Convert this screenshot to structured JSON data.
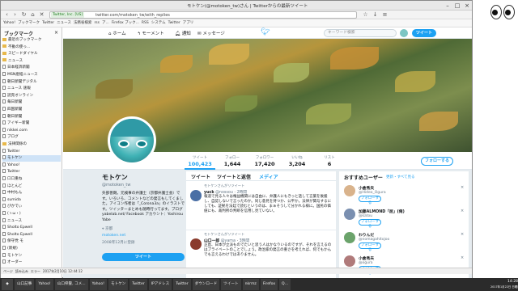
{
  "window": {
    "title": "モトケン(@motoken_tw)さん | Twitterからの最新ツイート"
  },
  "toolbar": {
    "url_badge": "Twitter, Inc. [US]",
    "url": "twitter.com/motoken_tw/with_replies"
  },
  "bookmarks": [
    "Yahoo!",
    "ブックマーク",
    "Twitter",
    "ニュース",
    "法務省検索",
    "rss",
    "ア...",
    "Firefox ブック...",
    "RSS",
    "システム",
    "Twitter",
    "アプリ"
  ],
  "sidebar": {
    "title": "ブックマーク",
    "rows": [
      "最近のブックマーク",
      "不動の使っ...",
      "スピードダイヤル",
      "ニュース",
      "日本経済新聞",
      "MSN産経ニュース",
      "朝日新聞デジタル",
      "ニュース 速報",
      "読売オンライン",
      "毎日新聞",
      "四国新聞",
      "朝日新聞",
      "アイギー新聞",
      "nikkei.com",
      "ブログ",
      "法律関係の",
      "Twitter",
      "モトケン",
      "Yahoo!",
      "Twitter",
      "口口重ね",
      "ほとんど",
      "中村もん",
      "sumida",
      "ぴかでぃ",
      "(ゝω・)",
      "ニュース",
      "Sholto Epwell",
      "Sholto Epwell",
      "保守党 モ",
      "(新規)",
      "モトケン",
      "オーダー"
    ]
  },
  "statusbar": [
    "ページ",
    "読み込み",
    "エラー",
    "2017年2月10日 12:44:12"
  ],
  "twitter": {
    "nav": {
      "home": "ホーム",
      "moments": "モーメント",
      "notifications": "通知",
      "messages": "メッセージ",
      "search_placeholder": "キーワード検索",
      "tweet": "ツイート"
    },
    "stats": [
      {
        "label": "ツイート",
        "value": "100,423"
      },
      {
        "label": "フォロー",
        "value": "1,644"
      },
      {
        "label": "フォロワー",
        "value": "17,420"
      },
      {
        "label": "いいね",
        "value": "3,204"
      },
      {
        "label": "リスト",
        "value": "6"
      }
    ],
    "follow_button": "フォローする",
    "profile": {
      "name": "モトケン",
      "handle": "@motoken_tw",
      "bio": "矢部善朗。元検事の弁護士（京都弁護士会）です。いろいろ、コメントなどの発言もしてくました。アイコン作者は「_Corona3a」のイラストです。ツイッターまとめも随時行ってます。ブログ yabelab.net/ Facebook アカウント：Yoshirou Yabe",
      "location": "京都",
      "link": "motoken.net",
      "joined": "2008年12月に登録",
      "tweet_button": "ツイート"
    },
    "tabs": [
      "ツイート",
      "ツイートと返信",
      "メディア"
    ],
    "tweets": [
      {
        "rt": "モトケンさんがリツイート",
        "name": "yuck",
        "handle": "@nossou",
        "time": "2時間",
        "text": "報道で見る人々は権益機関には自由に、弁護人にもきっと話して言葉を後援し、自認しないで言ったのか。同じ意見を持つか、公平か。法律が関与するにしても、証拠を法廷で読むというのは、まぁそうして分かれる様に。国民の価値にも、裁判所の判断を信用し見ていない。"
      },
      {
        "rt": "モトケンさんがリツイート",
        "name": "山口一郎",
        "handle": "@yama",
        "time": "3時間",
        "text": "正直、日本が立派ものでたいと思う人はかなりいるのですが、それを言えるのはプライベートのことでしょう。政治家の発言の重さを考えれば、何でもかんでも言えるわけではありません。"
      }
    ],
    "who_to_follow": {
      "title": "おすすめユーザー",
      "refresh": "更新・すべて見る",
      "users": [
        {
          "name": "小倉秀夫",
          "handle": "@Hideo_Ogura",
          "button": "フォローする"
        },
        {
          "name": "加藤ALMOND「屈」(俺)",
          "handle": "@katou",
          "button": "フォローする"
        },
        {
          "name": "わりんだ",
          "handle": "@nomagahitojoo",
          "button": "フォローする"
        },
        {
          "name": "小倉秀夫",
          "handle": "@ogura",
          "button": "フォローする"
        }
      ]
    }
  },
  "taskbar": [
    "山口記事",
    "Yahoo!",
    "山口県警, コメ...",
    "Yahoo!",
    "モトケン",
    "Twitter",
    "IPアドレス",
    "Twitter",
    "ダウンロード",
    "ツイート",
    "nkrmz",
    "Firefox",
    "Q..."
  ],
  "clock": {
    "time": "14:28",
    "date": "2017年1月22日 日曜日"
  }
}
